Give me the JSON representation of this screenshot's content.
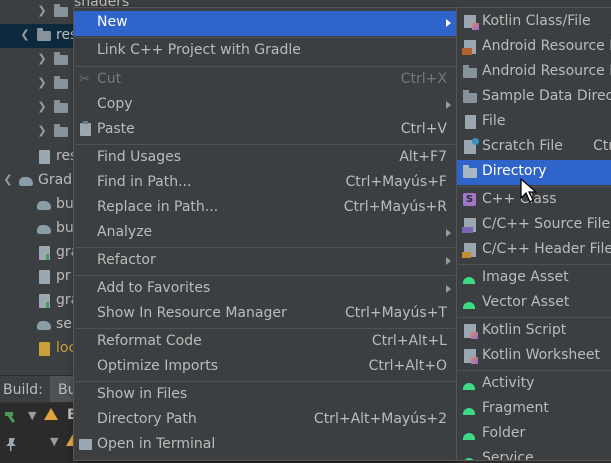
{
  "project_tree": {
    "rows": [
      {
        "label": "shaders",
        "indent": 2
      },
      {
        "label": "res",
        "indent": 1,
        "selected": true
      },
      {
        "label": "",
        "indent": 2
      },
      {
        "label": "",
        "indent": 2
      },
      {
        "label": "",
        "indent": 2
      },
      {
        "label": "",
        "indent": 2
      },
      {
        "label": "res",
        "indent": 2
      },
      {
        "label": "Grad",
        "indent": 0
      },
      {
        "label": "bu",
        "indent": 1
      },
      {
        "label": "bu",
        "indent": 1
      },
      {
        "label": "gra",
        "indent": 1
      },
      {
        "label": "pr",
        "indent": 1
      },
      {
        "label": "gra",
        "indent": 1
      },
      {
        "label": "se",
        "indent": 1
      },
      {
        "label": "loc",
        "indent": 1
      }
    ]
  },
  "build_panel": {
    "title": "Build:",
    "tab_label": "Bu",
    "row1_text": "E"
  },
  "context_menu": {
    "items": [
      {
        "label": "New",
        "shortcut": "",
        "submenu": true,
        "highlighted": true
      },
      {
        "label": "Link C++ Project with Gradle",
        "shortcut": ""
      },
      {
        "label": "Cut",
        "shortcut": "Ctrl+X",
        "disabled": true,
        "icon": "scissors-icon"
      },
      {
        "label": "Copy",
        "shortcut": "",
        "submenu": true
      },
      {
        "label": "Paste",
        "shortcut": "Ctrl+V",
        "icon": "paste-icon"
      },
      {
        "label": "Find Usages",
        "shortcut": "Alt+F7"
      },
      {
        "label": "Find in Path...",
        "shortcut": "Ctrl+Mayús+F"
      },
      {
        "label": "Replace in Path...",
        "shortcut": "Ctrl+Mayús+R"
      },
      {
        "label": "Analyze",
        "shortcut": "",
        "submenu": true
      },
      {
        "label": "Refactor",
        "shortcut": "",
        "submenu": true
      },
      {
        "label": "Add to Favorites",
        "shortcut": "",
        "submenu": true
      },
      {
        "label": "Show In Resource Manager",
        "shortcut": "Ctrl+Mayús+T"
      },
      {
        "label": "Reformat Code",
        "shortcut": "Ctrl+Alt+L"
      },
      {
        "label": "Optimize Imports",
        "shortcut": "Ctrl+Alt+O"
      },
      {
        "label": "Show in Files",
        "shortcut": ""
      },
      {
        "label": "Directory Path",
        "shortcut": "Ctrl+Alt+Mayús+2"
      },
      {
        "label": "Open in Terminal",
        "shortcut": "",
        "icon": "terminal-icon"
      }
    ]
  },
  "new_submenu": {
    "items": [
      {
        "label": "Kotlin Class/File",
        "icon": "kotlin-class-icon"
      },
      {
        "label": "Android Resource F",
        "icon": "android-resource-file-icon"
      },
      {
        "label": "Android Resource D",
        "icon": "folder-icon"
      },
      {
        "label": "Sample Data Direct",
        "icon": "folder-icon"
      },
      {
        "label": "File",
        "icon": "file-icon"
      },
      {
        "label": "Scratch File",
        "icon": "scratch-file-icon",
        "shortcut": "Ctr"
      },
      {
        "label": "Directory",
        "icon": "folder-icon",
        "highlighted": true
      },
      {
        "label": "C++ Class",
        "icon": "cpp-class-icon"
      },
      {
        "label": "C/C++ Source File",
        "icon": "cpp-source-icon"
      },
      {
        "label": "C/C++ Header File",
        "icon": "cpp-header-icon"
      },
      {
        "label": "Image Asset",
        "icon": "android-icon"
      },
      {
        "label": "Vector Asset",
        "icon": "android-icon"
      },
      {
        "label": "Kotlin Script",
        "icon": "kotlin-script-icon"
      },
      {
        "label": "Kotlin Worksheet",
        "icon": "kotlin-worksheet-icon"
      },
      {
        "label": "Activity",
        "icon": "android-icon"
      },
      {
        "label": "Fragment",
        "icon": "android-icon"
      },
      {
        "label": "Folder",
        "icon": "android-icon"
      },
      {
        "label": "Service",
        "icon": "android-icon"
      }
    ]
  },
  "colors": {
    "menu_bg": "#3c3f41",
    "highlight": "#2f65ca",
    "text": "#bbbbbb",
    "disabled_text": "#777777"
  }
}
